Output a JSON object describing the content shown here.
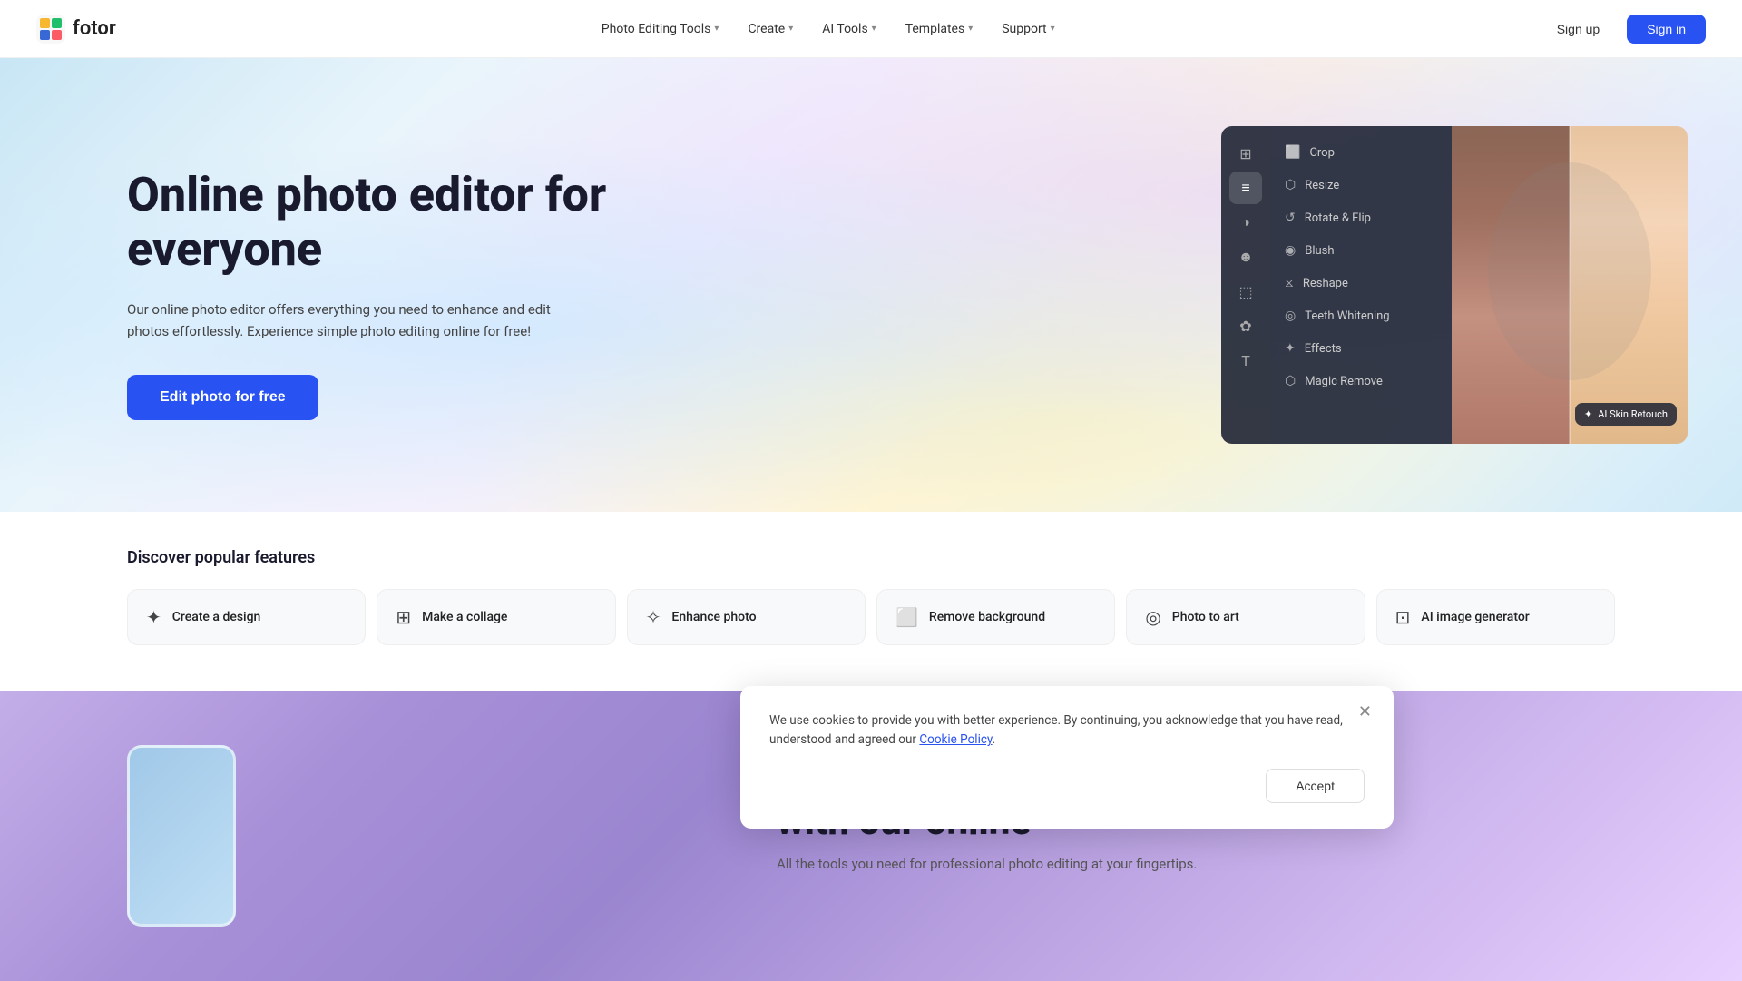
{
  "brand": {
    "name": "fotor"
  },
  "nav": {
    "links": [
      {
        "id": "photo-editing-tools",
        "label": "Photo Editing Tools",
        "hasDropdown": true
      },
      {
        "id": "create",
        "label": "Create",
        "hasDropdown": true
      },
      {
        "id": "ai-tools",
        "label": "AI Tools",
        "hasDropdown": true
      },
      {
        "id": "templates",
        "label": "Templates",
        "hasDropdown": true
      },
      {
        "id": "support",
        "label": "Support",
        "hasDropdown": true
      }
    ],
    "signup_label": "Sign up",
    "signin_label": "Sign in"
  },
  "hero": {
    "title": "Online photo editor for everyone",
    "subtitle": "Our online photo editor offers everything you need to enhance and edit photos effortlessly. Experience simple photo editing online for free!",
    "cta_label": "Edit photo for free"
  },
  "editor_panel": {
    "menu_items": [
      {
        "id": "crop",
        "label": "Crop",
        "icon": "⬜"
      },
      {
        "id": "resize",
        "label": "Resize",
        "icon": "⬡"
      },
      {
        "id": "rotate-flip",
        "label": "Rotate & Flip",
        "icon": "↺"
      },
      {
        "id": "blush",
        "label": "Blush",
        "icon": "◉"
      },
      {
        "id": "reshape",
        "label": "Reshape",
        "icon": "⧖"
      },
      {
        "id": "teeth-whitening",
        "label": "Teeth Whitening",
        "icon": "◎"
      },
      {
        "id": "effects",
        "label": "Effects",
        "icon": "✦"
      },
      {
        "id": "magic-remove",
        "label": "Magic Remove",
        "icon": "⬡"
      }
    ],
    "ai_badge_label": "AI Skin Retouch"
  },
  "features": {
    "section_title": "Discover popular features",
    "cards": [
      {
        "id": "create-a-design",
        "label": "Create a design",
        "icon": "✦"
      },
      {
        "id": "make-collage",
        "label": "Make a collage",
        "icon": "⊞"
      },
      {
        "id": "enhance-photo",
        "label": "Enhance photo",
        "icon": "✧"
      },
      {
        "id": "remove-background",
        "label": "Remove background",
        "icon": "⬜"
      },
      {
        "id": "photo-to-art",
        "label": "Photo to art",
        "icon": "◎"
      },
      {
        "id": "ai-image-generator",
        "label": "AI image generator",
        "icon": "⊡"
      }
    ]
  },
  "bottom": {
    "title": "with our online",
    "subtitle": "All the tools you need for professional photo editing at your fingertips."
  },
  "cookie": {
    "text": "We use cookies to provide you with better experience. By continuing, you acknowledge that you have read, understood and agreed our ",
    "link_text": "Cookie Policy",
    "link_suffix": ".",
    "accept_label": "Accept"
  }
}
